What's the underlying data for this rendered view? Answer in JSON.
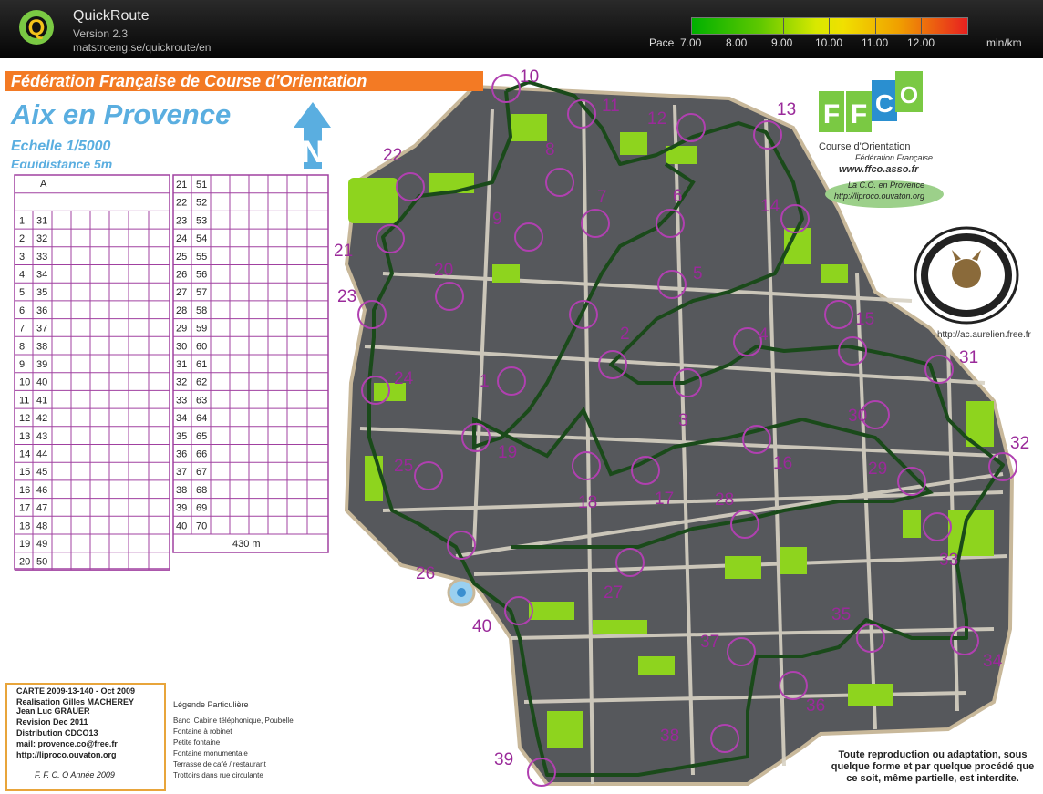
{
  "app": {
    "title": "QuickRoute",
    "version": "Version 2.3",
    "url": "matstroeng.se/quickroute/en"
  },
  "pace_scale": {
    "label": "Pace",
    "ticks": [
      "7.00",
      "8.00",
      "9.00",
      "10.00",
      "11.00",
      "12.00"
    ],
    "unit": "min/km",
    "colors": [
      "#00b000",
      "#60c800",
      "#c8e000",
      "#f0e000",
      "#f09000",
      "#e82020"
    ]
  },
  "map": {
    "federation_banner": "Fédération Française de Course d'Orientation",
    "city": "Aix en Provence",
    "scale": "Echelle 1/5000",
    "equidistance": "Equidistance 5m",
    "control_numbers": [
      "10",
      "11",
      "12",
      "13",
      "8",
      "22",
      "6",
      "14",
      "9",
      "7",
      "21",
      "5",
      "20",
      "23",
      "15",
      "4",
      "2",
      "31",
      "24",
      "1",
      "3",
      "30",
      "32",
      "19",
      "16",
      "29",
      "25",
      "18",
      "17",
      "28",
      "33",
      "26",
      "27",
      "40",
      "35",
      "34",
      "37",
      "36",
      "39",
      "38"
    ],
    "colors": {
      "route": "#1a4a1a",
      "control": "#b040b0",
      "green": "#8ed41e",
      "building": "#57595e"
    }
  },
  "control_table": {
    "left_header": "A",
    "left_rows": [
      [
        "1",
        "31"
      ],
      [
        "2",
        "32"
      ],
      [
        "3",
        "33"
      ],
      [
        "4",
        "34"
      ],
      [
        "5",
        "35"
      ],
      [
        "6",
        "36"
      ],
      [
        "7",
        "37"
      ],
      [
        "8",
        "38"
      ],
      [
        "9",
        "39"
      ],
      [
        "10",
        "40"
      ],
      [
        "11",
        "41"
      ],
      [
        "12",
        "42"
      ],
      [
        "13",
        "43"
      ],
      [
        "14",
        "44"
      ],
      [
        "15",
        "45"
      ],
      [
        "16",
        "46"
      ],
      [
        "17",
        "47"
      ],
      [
        "18",
        "48"
      ],
      [
        "19",
        "49"
      ],
      [
        "20",
        "50"
      ]
    ],
    "right_rows": [
      [
        "21",
        "51"
      ],
      [
        "22",
        "52"
      ],
      [
        "23",
        "53"
      ],
      [
        "24",
        "54"
      ],
      [
        "25",
        "55"
      ],
      [
        "26",
        "56"
      ],
      [
        "27",
        "57"
      ],
      [
        "28",
        "58"
      ],
      [
        "29",
        "59"
      ],
      [
        "30",
        "60"
      ],
      [
        "31",
        "61"
      ],
      [
        "32",
        "62"
      ],
      [
        "33",
        "63"
      ],
      [
        "34",
        "64"
      ],
      [
        "35",
        "65"
      ],
      [
        "36",
        "66"
      ],
      [
        "37",
        "67"
      ],
      [
        "38",
        "68"
      ],
      [
        "39",
        "69"
      ],
      [
        "40",
        "70"
      ]
    ],
    "finish_distance": "430 m"
  },
  "logos": {
    "ffco_sub": "Course d'Orientation",
    "ffco_sub2": "Fédération Française",
    "ffco_url": "www.ffco.asso.fr",
    "lico_1": "La C.O. en Provence",
    "lico_2": "http://liproco.ouvaton.org",
    "aurelien_url": "http://ac.aurelien.free.fr"
  },
  "info": {
    "lines": [
      "CARTE 2009-13-140 - Oct 2009",
      "Realisation  Gilles MACHEREY",
      "                 Jean Luc GRAUER",
      "Revision Dec 2011",
      "Distribution CDCO13",
      "mail: provence.co@free.fr",
      "http://liproco.ouvaton.org",
      "F. F. C. O Année 2009"
    ]
  },
  "legend": {
    "title": "Légende Particulière",
    "lines": [
      "Banc, Cabine téléphonique, Poubelle",
      "Fontaine à robinet",
      "Petite fontaine",
      "Fontaine monumentale",
      "Terrasse de café / restaurant",
      "Trottoirs dans rue circulante"
    ]
  },
  "copyright": "Toute reproduction ou adaptation, sous quelque forme et par quelque procédé que ce soit, même partielle, est interdite."
}
